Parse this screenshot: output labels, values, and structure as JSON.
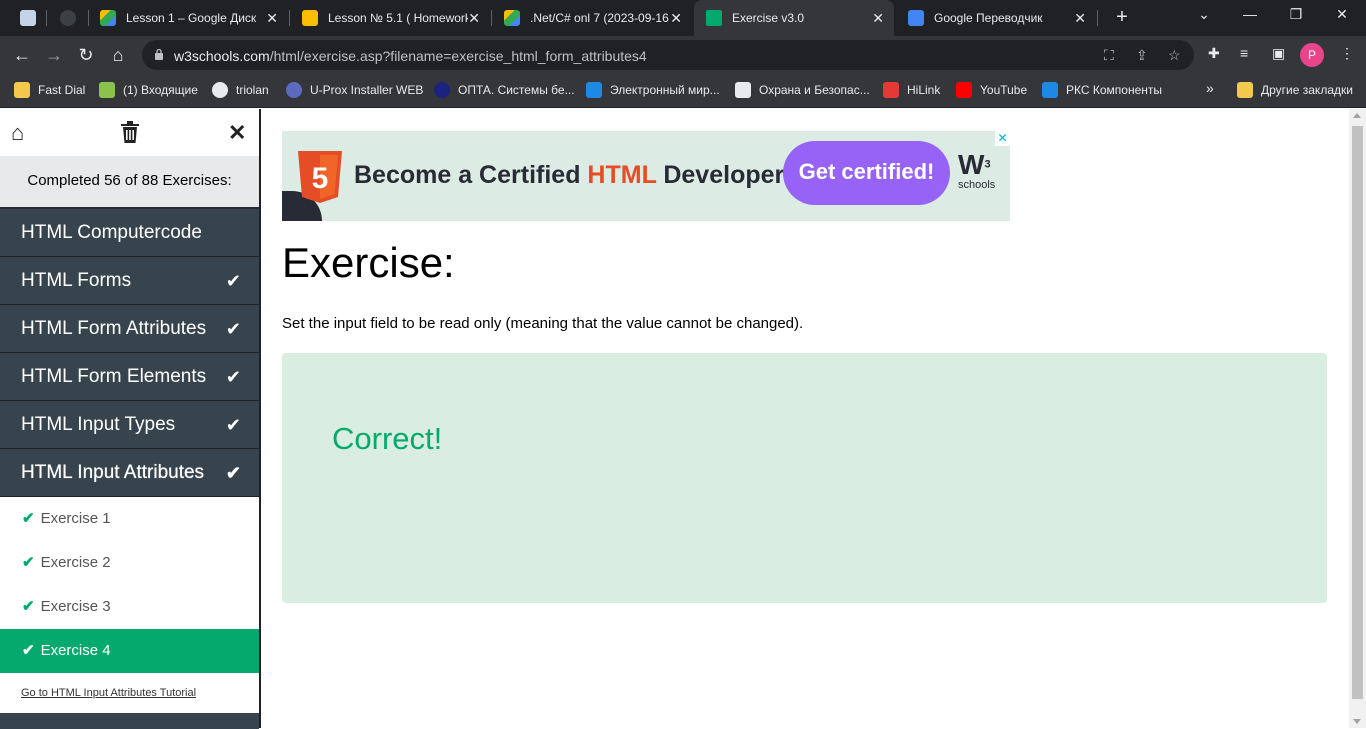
{
  "browser": {
    "tabs": [
      {
        "title": "Lesson 1 – Google Диск",
        "icon": "google-drive-icon"
      },
      {
        "title": "Lesson № 5.1 ( Homework",
        "icon": "google-slides-icon"
      },
      {
        "title": ".Net/C# onl 7 (2023-09-16",
        "icon": "google-drive-icon"
      },
      {
        "title": "Exercise v3.0",
        "icon": "w3schools-icon",
        "active": true
      },
      {
        "title": "Google Переводчик",
        "icon": "google-translate-icon"
      }
    ],
    "url_host": "w3schools.com",
    "url_path": "/html/exercise.asp?filename=exercise_html_form_attributes4",
    "profile_initial": "P",
    "bookmarks": [
      {
        "label": "Fast Dial",
        "color": "#f2c94c"
      },
      {
        "label": "(1) Входящие",
        "color": "#8bc34a"
      },
      {
        "label": "triolan",
        "color": "#e8eaed"
      },
      {
        "label": "U-Prox Installer WEB",
        "color": "#5c6bc0"
      },
      {
        "label": "ОПТА. Системы бе...",
        "color": "#1a237e"
      },
      {
        "label": "Электронный мир...",
        "color": "#1e88e5"
      },
      {
        "label": "Охрана и Безопас...",
        "color": "#e8eaed"
      },
      {
        "label": "HiLink",
        "color": "#e53935"
      },
      {
        "label": "YouTube",
        "color": "#ff0000"
      },
      {
        "label": "РКС Компоненты",
        "color": "#1e88e5"
      }
    ],
    "bookmarks_more": "»",
    "other_bookmarks": "Другие закладки"
  },
  "sidebar": {
    "progress": "Completed 56 of 88 Exercises:",
    "menu": [
      {
        "label": "HTML Computercode",
        "done": false
      },
      {
        "label": "HTML Forms",
        "done": true
      },
      {
        "label": "HTML Form Attributes",
        "done": true
      },
      {
        "label": "HTML Form Elements",
        "done": true
      },
      {
        "label": "HTML Input Types",
        "done": true
      },
      {
        "label": "HTML Input Attributes",
        "done": true
      }
    ],
    "exercises": [
      {
        "label": "Exercise 1",
        "done": true
      },
      {
        "label": "Exercise 2",
        "done": true
      },
      {
        "label": "Exercise 3",
        "done": true
      },
      {
        "label": "Exercise 4",
        "done": true,
        "active": true
      }
    ],
    "tutorial_link": "Go to HTML Input Attributes Tutorial"
  },
  "ad": {
    "headline_pre": "Become a Certified ",
    "headline_highlight": "HTML",
    "headline_post": " Developer!",
    "button": "Get certified!",
    "logo_main": "W",
    "logo_sup": "3",
    "logo_sub": "schools",
    "shield_text": "5",
    "close": "✕"
  },
  "main": {
    "heading": "Exercise:",
    "instructions": "Set the input field to be read only (meaning that the value cannot be changed).",
    "result": "Correct!"
  },
  "colors": {
    "accent": "#04aa6d",
    "sidebar_bg": "#38444d",
    "result_bg": "#d9eee1",
    "ad_button": "#9763f6"
  }
}
